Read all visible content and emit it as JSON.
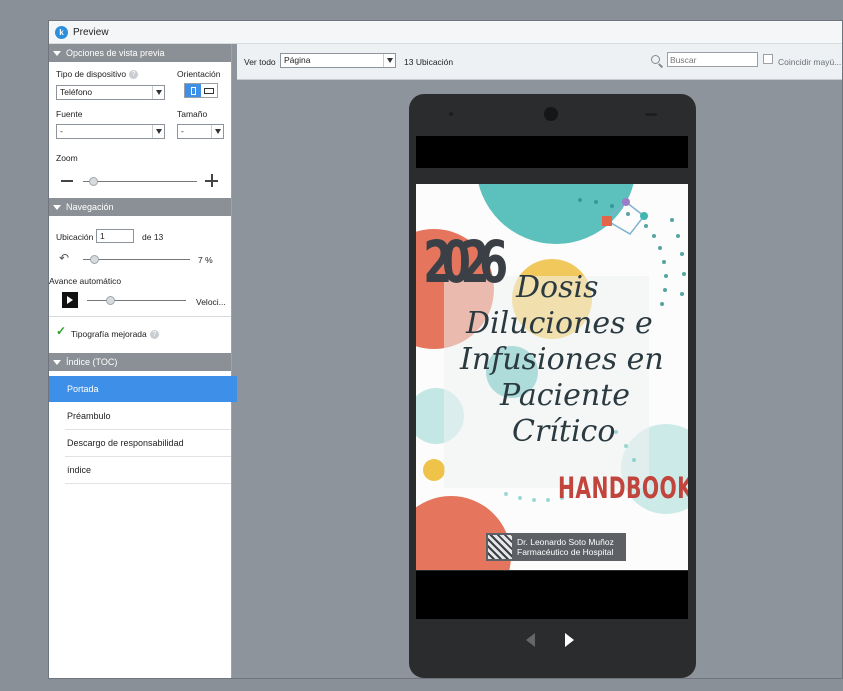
{
  "window": {
    "title": "Preview",
    "app_icon": "k"
  },
  "panel": {
    "preview_options": {
      "header": "Opciones de vista previa",
      "device_type_label": "Tipo de dispositivo",
      "device_type_value": "Teléfono",
      "orientation_label": "Orientación",
      "font_label": "Fuente",
      "font_value": "-",
      "size_label": "Tamaño",
      "size_value": "-",
      "zoom_label": "Zoom",
      "zoom_level": 0.05
    },
    "navigation": {
      "header": "Navegación",
      "location_label": "Ubicación",
      "location_value": "1",
      "of_label": "de 13",
      "progress_text": "7 %",
      "progress": 0.07,
      "auto_advance_label": "Avance automático",
      "speed_label": "Veloci..."
    },
    "typography": {
      "label": "Tipografía mejorada",
      "checked": true
    },
    "toc": {
      "header": "Índice (TOC)",
      "items": [
        {
          "label": "Portada",
          "active": true
        },
        {
          "label": "Préambulo",
          "active": false
        },
        {
          "label": "Descargo de responsabilidad",
          "active": false
        },
        {
          "label": "índice",
          "active": false
        }
      ]
    }
  },
  "toolbar": {
    "view_all": "Ver todo",
    "view_mode": "Página",
    "location_count": "13 Ubicación",
    "search_placeholder": "Buscar",
    "match_case": "Coincidir mayú..."
  },
  "cover": {
    "year": "2026",
    "title_lines": [
      "Dosis",
      "Diluciones e",
      "Infusiones en",
      "Paciente",
      "Crítico"
    ],
    "subtitle": "HANDBOOK",
    "author": "Dr. Leonardo Soto Muñoz",
    "role": "Farmacéutico de Hospital",
    "colors": {
      "teal": "#3fb6b0",
      "orange_red": "#e2664a",
      "yellow": "#efc24a",
      "dark_gray": "#3b3f46",
      "red": "#c1443d"
    }
  }
}
